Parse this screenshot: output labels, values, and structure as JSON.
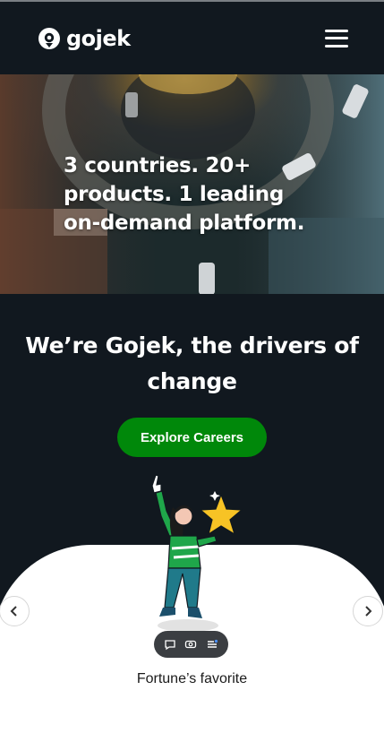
{
  "header": {
    "logo_text": "gojek",
    "logo_icon": "gojek-logo-icon",
    "menu_icon": "hamburger-menu-icon"
  },
  "hero": {
    "line1": "3 countries. 20+",
    "line2": "products. 1 leading",
    "line3": "on-demand platform."
  },
  "mission": {
    "line1": "We’re Gojek, the drivers of",
    "line2": "change"
  },
  "cta": {
    "label": "Explore Careers"
  },
  "carousel": {
    "prev_icon": "chevron-left-icon",
    "next_icon": "chevron-right-icon",
    "caption": "Fortune’s favorite"
  },
  "floating_toolbar": {
    "icons": [
      "chat-bubble-icon",
      "toggle-icon",
      "list-icon"
    ]
  },
  "colors": {
    "background": "#11181f",
    "accent_green": "#00880a",
    "card": "#ffffff",
    "star": "#f7c325"
  }
}
